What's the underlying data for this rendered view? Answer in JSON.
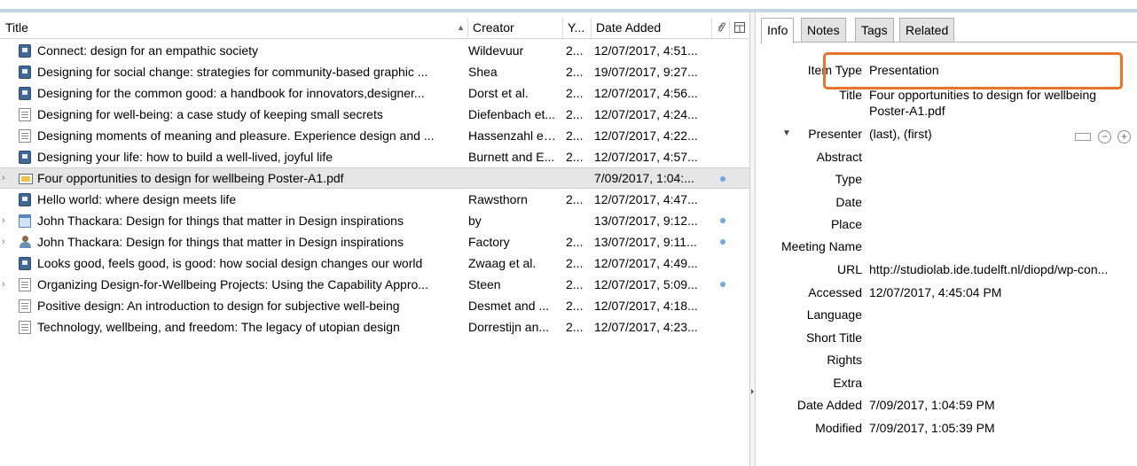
{
  "columns": {
    "title": "Title",
    "creator": "Creator",
    "year": "Y...",
    "date_added": "Date Added",
    "attachments_icon": "paperclip-icon",
    "column_picker_icon": "column-picker-icon"
  },
  "items": [
    {
      "icon": "book-icon",
      "twisty": "",
      "title": "Connect: design for an empathic society",
      "creator": "Wildevuur",
      "year": "2...",
      "date_added": "12/07/2017, 4:51...",
      "has_attachment": false
    },
    {
      "icon": "book-icon",
      "twisty": "",
      "title": "Designing for social change: strategies for community-based graphic ...",
      "creator": "Shea",
      "year": "2...",
      "date_added": "19/07/2017, 9:27...",
      "has_attachment": false
    },
    {
      "icon": "book-icon",
      "twisty": "",
      "title": "Designing for the common good: a handbook for innovators,designer...",
      "creator": "Dorst et al.",
      "year": "2...",
      "date_added": "12/07/2017, 4:56...",
      "has_attachment": false
    },
    {
      "icon": "document-icon",
      "twisty": "",
      "title": "Designing for well-being: a case study of keeping small secrets",
      "creator": "Diefenbach et...",
      "year": "2...",
      "date_added": "12/07/2017, 4:24...",
      "has_attachment": false
    },
    {
      "icon": "document-icon",
      "twisty": "",
      "title": "Designing moments of meaning and pleasure. Experience design and ...",
      "creator": "Hassenzahl et...",
      "year": "2...",
      "date_added": "12/07/2017, 4:22...",
      "has_attachment": false
    },
    {
      "icon": "book-icon",
      "twisty": "",
      "title": "Designing your life: how to build a well-lived, joyful life",
      "creator": "Burnett and E...",
      "year": "2...",
      "date_added": "12/07/2017, 4:57...",
      "has_attachment": false
    },
    {
      "icon": "presentation-icon",
      "twisty": "›",
      "title": "Four opportunities to design for wellbeing Poster-A1.pdf",
      "creator": "",
      "year": "",
      "date_added": "7/09/2017, 1:04:...",
      "has_attachment": true,
      "selected": true
    },
    {
      "icon": "book-icon",
      "twisty": "",
      "title": "Hello world: where design meets life",
      "creator": "Rawsthorn",
      "year": "2...",
      "date_added": "12/07/2017, 4:47...",
      "has_attachment": false
    },
    {
      "icon": "webpage-icon",
      "twisty": "›",
      "title": "John Thackara: Design for things that matter in Design inspirations",
      "creator": "by",
      "year": "",
      "date_added": "13/07/2017, 9:12...",
      "has_attachment": true
    },
    {
      "icon": "person-icon",
      "twisty": "›",
      "title": "John Thackara: Design for things that matter in Design inspirations",
      "creator": "Factory",
      "year": "2...",
      "date_added": "13/07/2017, 9:11...",
      "has_attachment": true
    },
    {
      "icon": "book-icon",
      "twisty": "",
      "title": "Looks good, feels good, is good: how social design changes our world",
      "creator": "Zwaag et al.",
      "year": "2...",
      "date_added": "12/07/2017, 4:49...",
      "has_attachment": false
    },
    {
      "icon": "document-icon",
      "twisty": "›",
      "title": "Organizing Design-for-Wellbeing Projects: Using the Capability Appro...",
      "creator": "Steen",
      "year": "2...",
      "date_added": "12/07/2017, 5:09...",
      "has_attachment": true
    },
    {
      "icon": "document-icon",
      "twisty": "",
      "title": "Positive design: An introduction to design for subjective well-being",
      "creator": "Desmet and ...",
      "year": "2...",
      "date_added": "12/07/2017, 4:18...",
      "has_attachment": false
    },
    {
      "icon": "document-icon",
      "twisty": "",
      "title": "Technology, wellbeing, and freedom: The legacy of utopian design",
      "creator": "Dorrestijn an...",
      "year": "2...",
      "date_added": "12/07/2017, 4:23...",
      "has_attachment": false
    }
  ],
  "tabs": [
    "Info",
    "Notes",
    "Tags",
    "Related"
  ],
  "active_tab": "Info",
  "info": {
    "item_type_label": "Item Type",
    "item_type_value": "Presentation",
    "title_label": "Title",
    "title_value_line1": "Four opportunities to design for wellbeing",
    "title_value_line2": "Poster-A1.pdf",
    "presenter_label": "Presenter",
    "presenter_value": "(last), (first)",
    "abstract_label": "Abstract",
    "type_label": "Type",
    "date_label": "Date",
    "place_label": "Place",
    "meeting_name_label": "Meeting Name",
    "url_label": "URL",
    "url_value": "http://studiolab.ide.tudelft.nl/diopd/wp-con...",
    "accessed_label": "Accessed",
    "accessed_value": "12/07/2017, 4:45:04 PM",
    "language_label": "Language",
    "short_title_label": "Short Title",
    "rights_label": "Rights",
    "extra_label": "Extra",
    "date_added_label": "Date Added",
    "date_added_value": "7/09/2017, 1:04:59 PM",
    "modified_label": "Modified",
    "modified_value": "7/09/2017, 1:05:39 PM"
  },
  "colors": {
    "highlight": "#e8732a",
    "selected_row": "#e6e6e6",
    "attachment_dot": "#6fa8dc"
  }
}
